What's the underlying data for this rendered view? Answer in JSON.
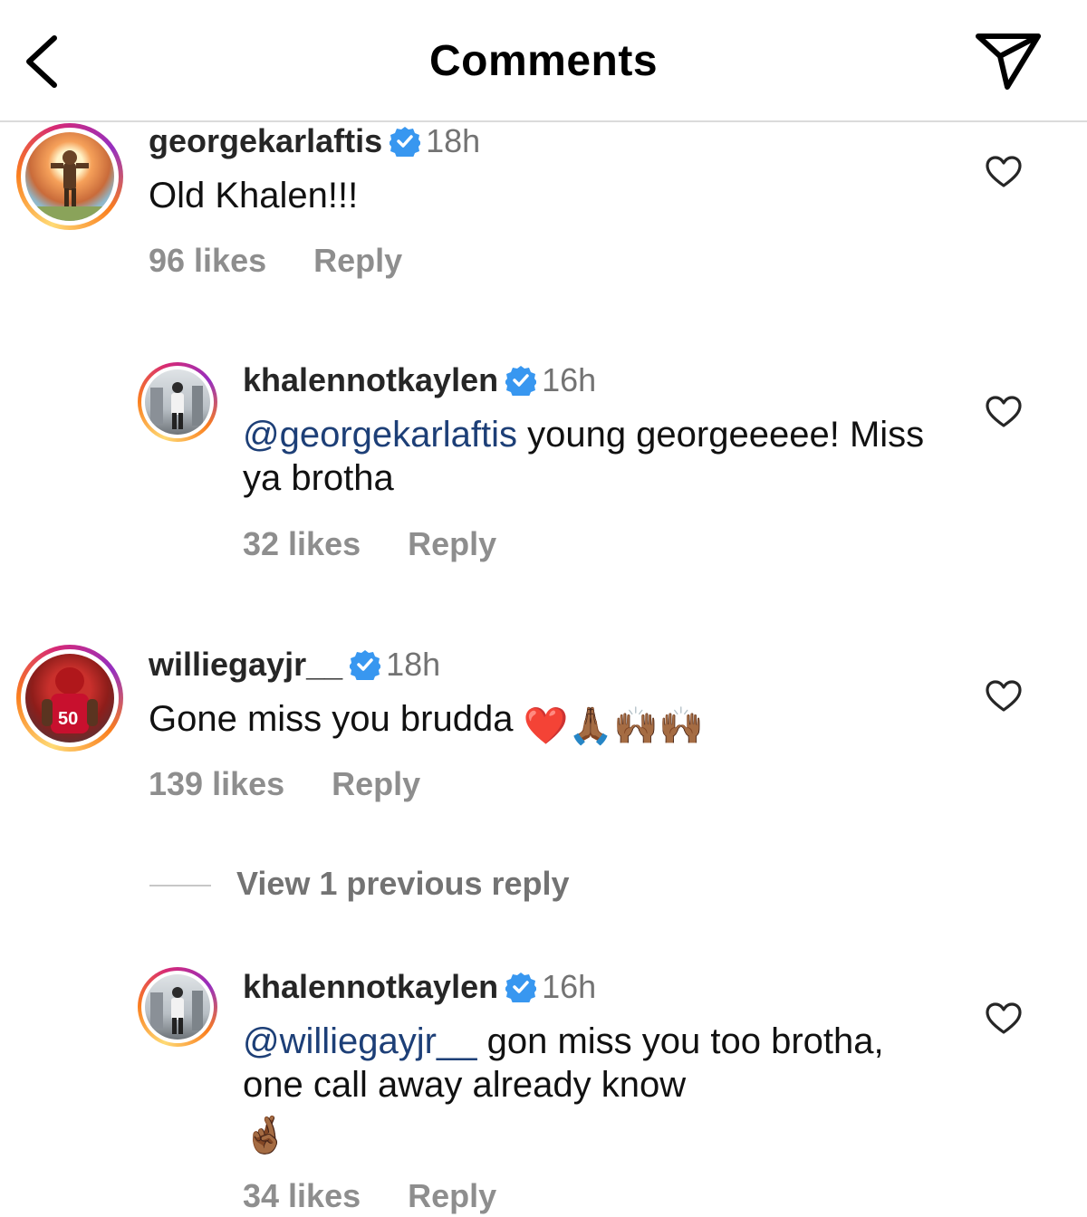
{
  "header": {
    "title": "Comments",
    "back_icon": "chevron-left-icon",
    "share_icon": "send-icon"
  },
  "comments": [
    {
      "username": "georgekarlaftis",
      "verified": true,
      "time": "18h",
      "text": "Old Khalen!!!",
      "likes": "96 likes",
      "reply": "Reply"
    },
    {
      "username": "khalennotkaylen",
      "verified": true,
      "time": "16h",
      "mention": "@georgekarlaftis",
      "text": " young georgeeeee! Miss ya brotha",
      "likes": "32 likes",
      "reply": "Reply"
    },
    {
      "username": "williegayjr__",
      "verified": true,
      "time": "18h",
      "text": "Gone miss you brudda",
      "emojis": "❤️🙏🏾🙌🏾🙌🏾",
      "likes": "139 likes",
      "reply": "Reply"
    },
    {
      "username": "khalennotkaylen",
      "verified": true,
      "time": "16h",
      "mention": "@williegayjr__",
      "text": " gon miss you too brotha, one call away already know",
      "emojis": "🤞🏾",
      "likes": "34 likes",
      "reply": "Reply"
    }
  ],
  "view_replies": "View 1 previous reply",
  "colors": {
    "verified": "#3897f0",
    "mention": "#1d3f77",
    "secondary_text": "#8e8e8e"
  }
}
